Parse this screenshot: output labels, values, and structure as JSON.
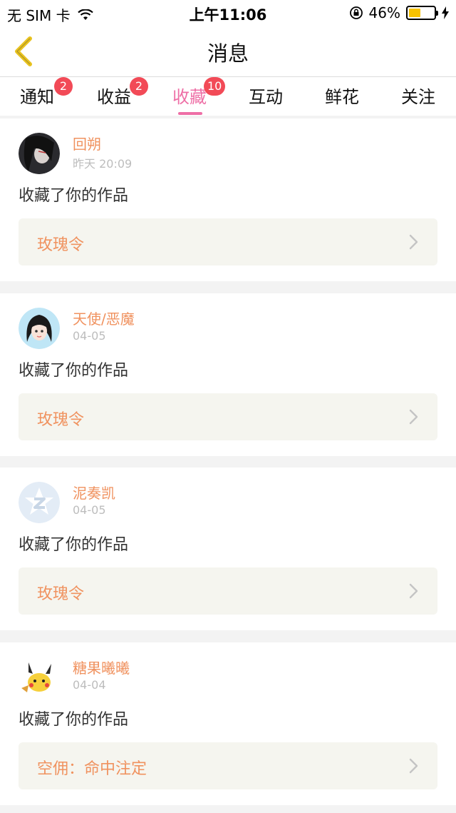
{
  "status_bar": {
    "carrier": "无 SIM 卡",
    "time": "上午11:06",
    "battery": "46%",
    "battery_level": 0.46
  },
  "nav": {
    "title": "消息",
    "back_icon": "chevron-left-icon"
  },
  "tabs": [
    {
      "label": "通知",
      "badge": "2"
    },
    {
      "label": "收益",
      "badge": "2"
    },
    {
      "label": "收藏",
      "badge": "10",
      "active": true
    },
    {
      "label": "互动"
    },
    {
      "label": "鲜花"
    },
    {
      "label": "关注"
    }
  ],
  "messages": [
    {
      "username": "回朔",
      "time": "昨天 20:09",
      "action": "收藏了你的作品",
      "work": "玫瑰令"
    },
    {
      "username": "天使/恶魔",
      "time": "04-05",
      "action": "收藏了你的作品",
      "work": "玫瑰令"
    },
    {
      "username": "泥奏凯",
      "time": "04-05",
      "action": "收藏了你的作品",
      "work": "玫瑰令"
    },
    {
      "username": "糖果曦曦",
      "time": "04-04",
      "action": "收藏了你的作品",
      "work": "空佣：命中注定"
    }
  ],
  "colors": {
    "accent": "#ee6fa6",
    "username": "#f0925f",
    "badge": "#f24a57",
    "back_arrow": "#e8c21e"
  }
}
